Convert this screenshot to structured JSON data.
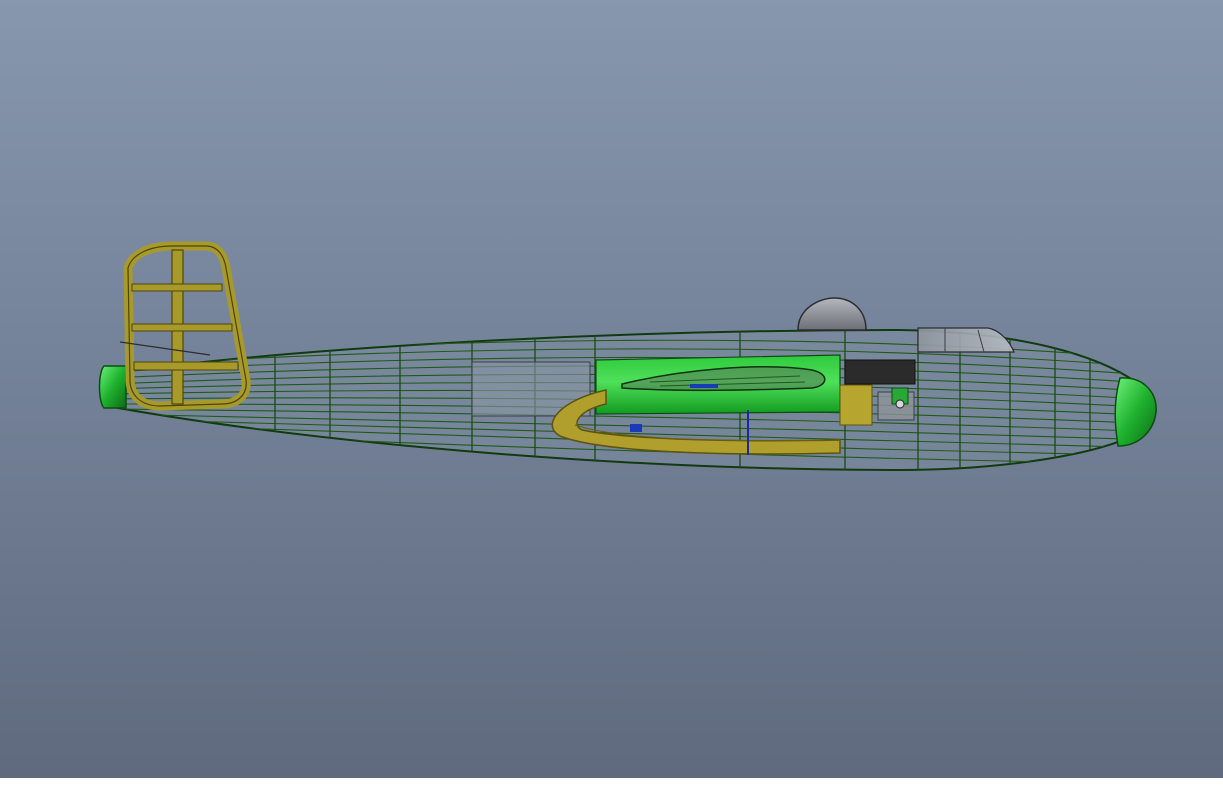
{
  "viewport": {
    "background_top": "#8797ad",
    "background_bottom": "#5f6a7e"
  },
  "model": {
    "subject": "aircraft-fuselage-model",
    "colors": {
      "frame_wire": "#1f4d1a",
      "skin_green": "#1fae2c",
      "skin_green_light": "#54e05e",
      "wood_structure": "#a89a2a",
      "wood_dark": "#5e5410",
      "canopy_glass": "#9aa3ad",
      "turret_gray": "#8d9298",
      "interior_dark": "#2b2b2b",
      "accent_blue": "#1a3bb8"
    }
  }
}
